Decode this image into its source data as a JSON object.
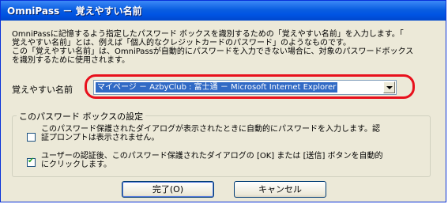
{
  "window": {
    "title": "OmniPass － 覚えやすい名前"
  },
  "description": {
    "line1": "OmniPassに記憶するよう指定したパスワード ボックスを識別するための「覚えやすい名前」を入力します。「",
    "line2": "覚えやすい名前」とは、例えば「個人的なクレジットカードのパスワード」のようなものです。",
    "line3": "この「覚えやすい名前」は、OmniPassが自動的にパスワードを入力できない場合に、対象のパスワードボックス",
    "line4": "を識別するために使用されます。"
  },
  "friendly_name": {
    "label": "覚えやすい名前",
    "value": "マイページ － AzbyClub : 富士通 － Microsoft Internet Explorer"
  },
  "settings_group": {
    "title": "このパスワード ボックスの設定",
    "option1": {
      "line1": "このパスワード保護されたダイアログが表示されたときに自動的にパスワードを入力します。認",
      "line2": "証プロンプトは表示されません。",
      "checked": false
    },
    "option2": {
      "line1": "ユーザーの認証後、このパスワード保護されたダイアログの [OK] または [送信] ボタンを自動的",
      "line2": "にクリックします。",
      "checked": true
    }
  },
  "buttons": {
    "ok": "完了(O)",
    "cancel": "キャンセル"
  },
  "highlight_color": "#e8101c"
}
